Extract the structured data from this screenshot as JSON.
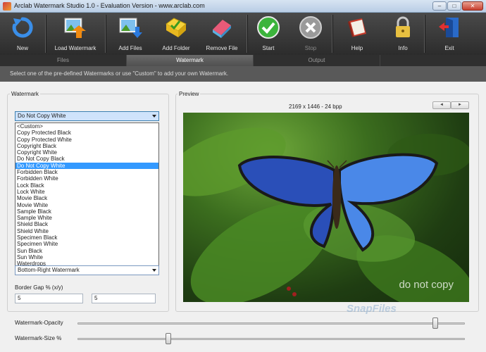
{
  "window": {
    "title": "Arclab Watermark Studio 1.0 - Evaluation Version - www.arclab.com"
  },
  "toolbar": {
    "buttons": [
      {
        "label": "New",
        "icon": "refresh-arrow-icon",
        "enabled": true
      },
      {
        "label": "Load Watermark",
        "icon": "picture-arrow-icon",
        "enabled": true
      },
      {
        "label": "Add Files",
        "icon": "picture-add-icon",
        "enabled": true
      },
      {
        "label": "Add Folder",
        "icon": "folder-icon",
        "enabled": true
      },
      {
        "label": "Remove File",
        "icon": "eraser-icon",
        "enabled": true
      },
      {
        "label": "Start",
        "icon": "checkmark-icon",
        "enabled": true
      },
      {
        "label": "Stop",
        "icon": "stop-x-icon",
        "enabled": false
      },
      {
        "label": "Help",
        "icon": "book-icon",
        "enabled": true
      },
      {
        "label": "Info",
        "icon": "lock-icon",
        "enabled": true
      },
      {
        "label": "Exit",
        "icon": "door-exit-icon",
        "enabled": true
      }
    ]
  },
  "tabs": [
    {
      "label": "Files",
      "active": false
    },
    {
      "label": "Watermark",
      "active": true
    },
    {
      "label": "Output",
      "active": false
    }
  ],
  "hint": "Select one of the pre-defined Watermarks or use \"Custom\" to add your own Watermark.",
  "watermark_panel": {
    "title": "Watermark",
    "selected": "Do Not Copy White",
    "options": [
      "<Custom>",
      "Copy Protected Black",
      "Copy Protected White",
      "Copyright Black",
      "Copyright White",
      "Do Not Copy Black",
      "Do Not Copy White",
      "Forbidden Black",
      "Forbidden White",
      "Lock Black",
      "Lock White",
      "Movie Black",
      "Movie White",
      "Sample Black",
      "Sample White",
      "Shield Black",
      "Shield White",
      "Specimen Black",
      "Specimen White",
      "Sun Black",
      "Sun White",
      "Waterdrops"
    ],
    "position_value": "Bottom-Right Watermark",
    "border_gap_label": "Border Gap % (x/y)",
    "border_gap_x": "5",
    "border_gap_y": "5"
  },
  "preview": {
    "title": "Preview",
    "image_info": "2169 x 1446 - 24 bpp",
    "prev_label": "◄",
    "next_label": "►",
    "watermark_text": "do not copy",
    "overlay_text": "SnapFiles"
  },
  "sliders": {
    "opacity_label": "Watermark-Opacity",
    "size_label": "Watermark-Size %",
    "opacity_fraction": 0.93,
    "size_fraction": 0.23
  },
  "colors": {
    "toolbar_bg": "#2c2c2c",
    "selection": "#3399ff",
    "active_tab": "#505050"
  }
}
